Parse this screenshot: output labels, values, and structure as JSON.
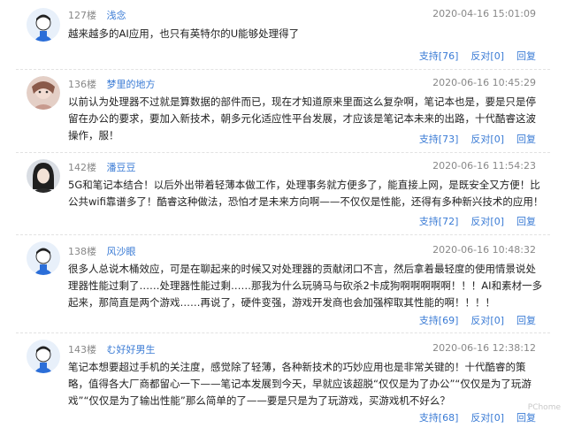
{
  "comments": [
    {
      "floor": "127楼",
      "user": "浅念",
      "time": "2020-04-16 15:01:09",
      "text": "越来越多的AI应用，也只有英特尔的U能够处理得了",
      "support": "支持[76]",
      "oppose": "反对[0]",
      "reply": "回复"
    },
    {
      "floor": "136楼",
      "user": "梦里的地方",
      "time": "2020-06-16 10:45:29",
      "text": "以前认为处理器不过就是算数据的部件而已，现在才知道原来里面这么复杂啊，笔记本也是，要是只是停留在办公的要求，要加入新技术，朝多元化适应性平台发展，才应该是笔记本未来的出路，十代酷睿这波操作，服！",
      "support": "支持[73]",
      "oppose": "反对[0]",
      "reply": "回复"
    },
    {
      "floor": "142楼",
      "user": "潘豆豆",
      "time": "2020-06-16 11:54:23",
      "text": "5G和笔记本结合！以后外出带着轻薄本做工作，处理事务就方便多了，能直接上网，是既安全又方便！比公共wifi靠谱多了！酷睿这种做法，恐怕才是未来方向啊——不仅仅是性能，还得有多种新兴技术的应用！",
      "support": "支持[72]",
      "oppose": "反对[0]",
      "reply": "回复"
    },
    {
      "floor": "138楼",
      "user": "风沙眼",
      "time": "2020-06-16 10:48:32",
      "text": "很多人总说木桶效应，可是在聊起来的时候又对处理器的贡献闭口不言，然后拿着最轻度的使用情景说处理器性能过剩了……处理器性能过剩……那我为什么玩骑马与砍杀2卡成狗啊啊啊啊啊！！！AI和素材一多起来，那简直是两个游戏……再说了，硬件变强，游戏开发商也会加强榨取其性能的啊！！！！",
      "support": "支持[69]",
      "oppose": "反对[0]",
      "reply": "回复"
    },
    {
      "floor": "143楼",
      "user": "む好好男生",
      "time": "2020-06-16 12:38:12",
      "text": "笔记本想要超过手机的关注度，感觉除了轻薄，各种新技术的巧妙应用也是非常关键的！十代酷睿的策略，值得各大厂商都留心一下——笔记本发展到今天，早就应该超脱“仅仅是为了办公”“仅仅是为了玩游戏”“仅仅是为了输出性能”那么简单的了——要是只是为了玩游戏，买游戏机不好么？",
      "support": "支持[68]",
      "oppose": "反对[0]",
      "reply": "回复"
    }
  ],
  "watermark": "PChome",
  "colors": {
    "link": "#3a7bd5",
    "meta": "#888888",
    "text": "#222222"
  },
  "avatars": [
    "default-avatar-icon",
    "user-photo-avatar",
    "user-photo-avatar",
    "default-avatar-icon",
    "default-avatar-icon"
  ]
}
